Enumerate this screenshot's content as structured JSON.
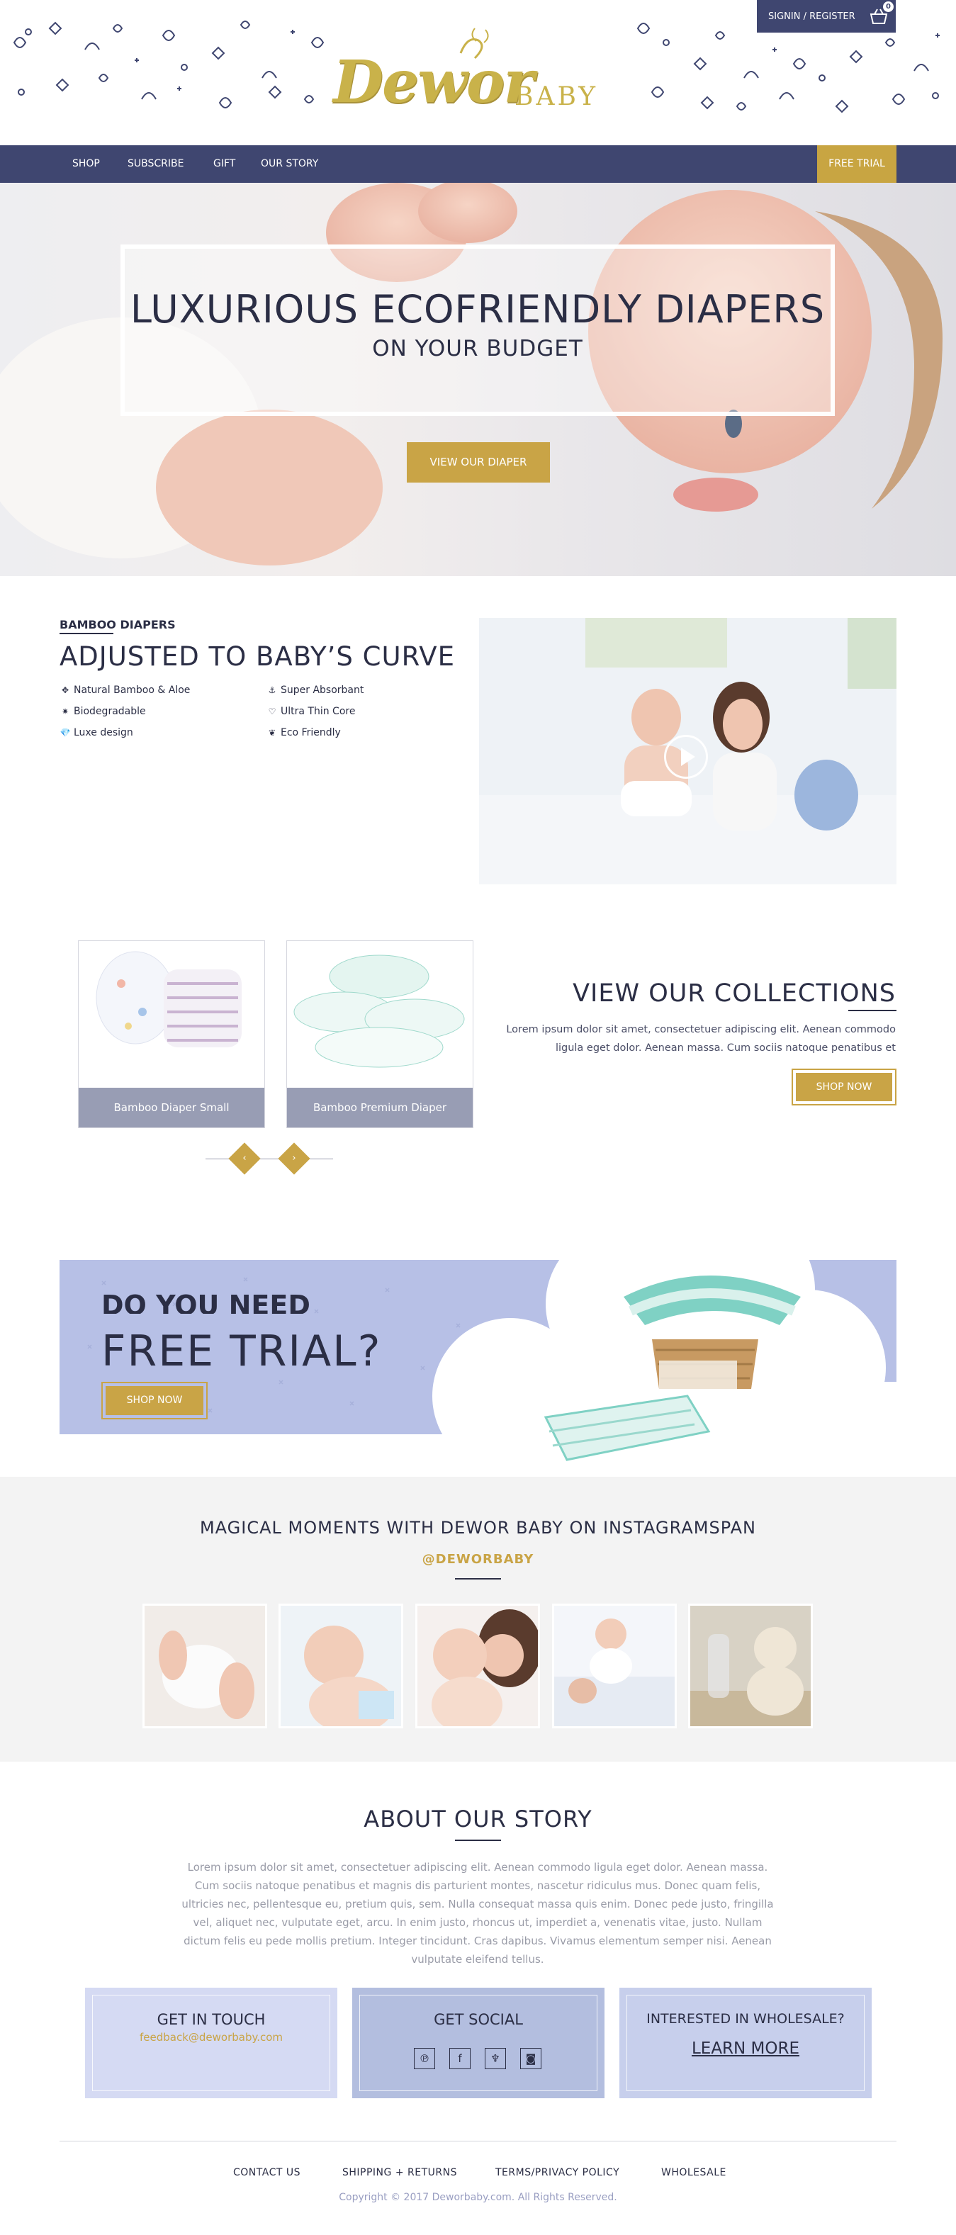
{
  "header": {
    "logo_script": "Dewor",
    "logo_word": "BABY",
    "signin_label": "SIGNIN / REGISTER",
    "cart_count": "0"
  },
  "nav": {
    "items": [
      "SHOP",
      "SUBSCRIBE",
      "GIFT",
      "OUR STORY"
    ],
    "cta": "FREE TRIAL"
  },
  "hero": {
    "title": "LUXURIOUS ECOFRIENDLY DIAPERS",
    "subtitle": "ON YOUR BUDGET",
    "button": "VIEW OUR DIAPER"
  },
  "bamboo": {
    "kicker": "BAMBOO DIAPERS",
    "title": "ADJUSTED TO BABY’S CURVE",
    "features": [
      {
        "icon": "leaf-icon",
        "glyph": "✥",
        "label": "Natural Bamboo & Aloe"
      },
      {
        "icon": "drop-icon",
        "glyph": "⚓",
        "label": "Super Absorbant"
      },
      {
        "icon": "recycle-icon",
        "glyph": "✷",
        "label": "Biodegradable"
      },
      {
        "icon": "heart-icon",
        "glyph": "♡",
        "label": "Ultra Thin Core"
      },
      {
        "icon": "diamond-icon",
        "glyph": "💎",
        "label": "Luxe design"
      },
      {
        "icon": "eco-leaf-icon",
        "glyph": "❦",
        "label": "Eco Friendly"
      }
    ]
  },
  "collections": {
    "cards": [
      "Bamboo Diaper Small",
      "Bamboo Premium Diaper"
    ],
    "prev": "‹",
    "next": "›",
    "title": "VIEW OUR COLLECTIONS",
    "text": "Lorem ipsum dolor sit amet, consectetuer adipiscing elit. Aenean commodo ligula eget dolor. Aenean massa. Cum sociis natoque penatibus et",
    "button": "SHOP NOW"
  },
  "trial": {
    "question": "DO YOU NEED",
    "title": "FREE TRIAL?",
    "button": "SHOP NOW"
  },
  "instagram": {
    "title": "MAGICAL MOMENTS WITH DEWOR BABY ON INSTAGRAMSPAN",
    "handle": "@DEWORBABY"
  },
  "story": {
    "title": "ABOUT OUR STORY",
    "text": "Lorem ipsum dolor sit amet, consectetuer adipiscing elit. Aenean commodo ligula eget dolor. Aenean massa. Cum sociis natoque penatibus et magnis dis parturient montes, nascetur ridiculus mus. Donec quam felis, ultricies nec, pellentesque eu, pretium quis, sem. Nulla consequat massa quis enim. Donec pede justo, fringilla vel, aliquet nec, vulputate eget, arcu. In enim justo, rhoncus ut, imperdiet a, venenatis vitae, justo. Nullam dictum felis eu pede mollis pretium. Integer tincidunt. Cras dapibus. Vivamus elementum semper nisi. Aenean vulputate eleifend tellus."
  },
  "contact": {
    "touch_title": "GET IN TOUCH",
    "email": "feedback@deworbaby.com",
    "social_title": "GET SOCIAL",
    "social_icons": [
      "pinterest-icon",
      "facebook-icon",
      "twitter-icon",
      "instagram-icon"
    ],
    "wholesale_title": "INTERESTED IN WHOLESALE?",
    "wholesale_link": "LEARN MORE"
  },
  "footer": {
    "links": [
      "CONTACT US",
      "SHIPPING + RETURNS",
      "TERMS/PRIVACY POLICY",
      "WHOLESALE"
    ],
    "copyright": "Copyright © 2017 Deworbaby.com. All Rights Reserved."
  },
  "colors": {
    "navy": "#3f4670",
    "gold": "#c9a446",
    "trial_bg": "#b7c0e6",
    "instagram_bg": "#f3f3f3"
  }
}
